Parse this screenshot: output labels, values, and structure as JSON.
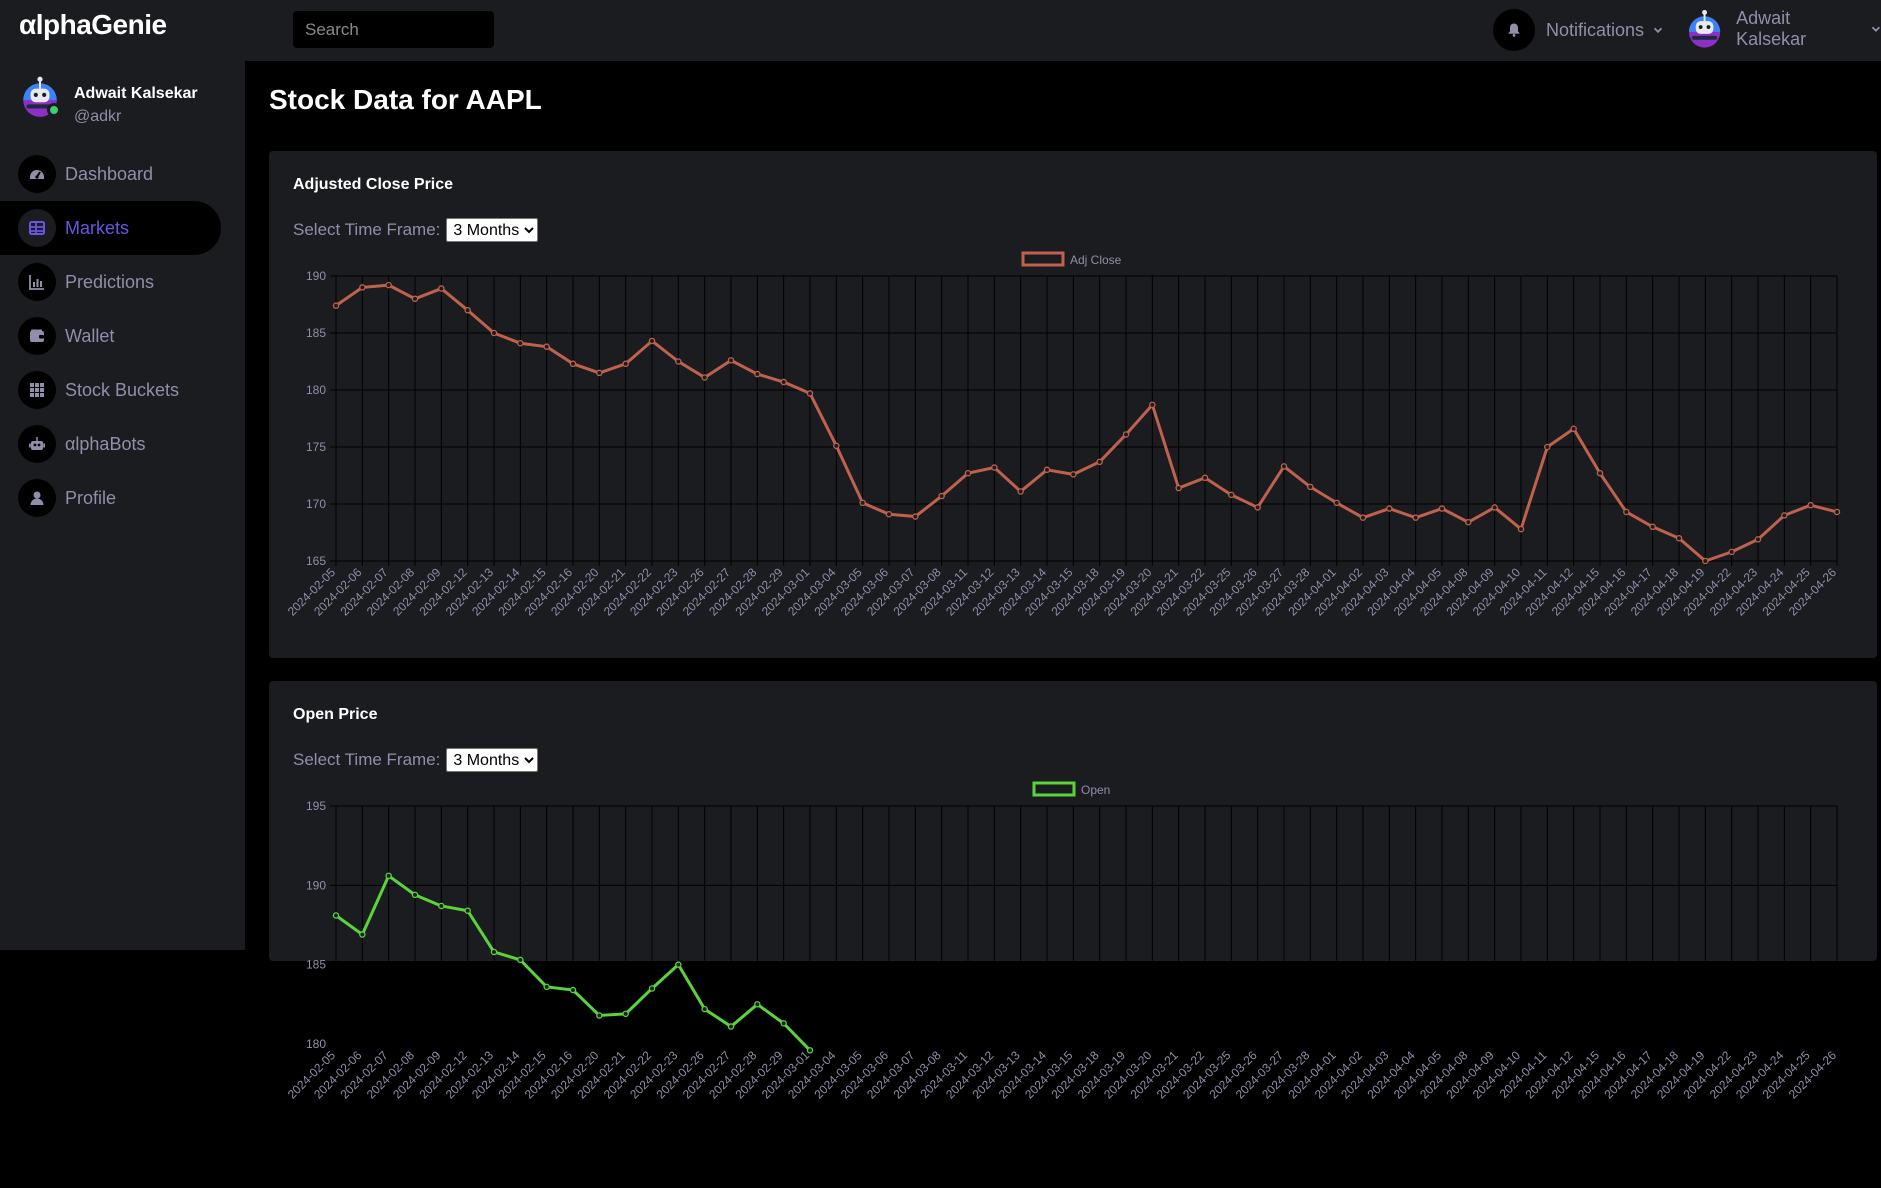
{
  "app": {
    "logo": "αlphaGenie"
  },
  "search": {
    "placeholder": "Search"
  },
  "header": {
    "notifications_label": "Notifications",
    "user_name": "Adwait Kalsekar"
  },
  "profile": {
    "name": "Adwait Kalsekar",
    "handle": "@adkr"
  },
  "sidebar": {
    "items": [
      {
        "label": "Dashboard",
        "icon": "dashboard-icon",
        "active": false
      },
      {
        "label": "Markets",
        "icon": "table-icon",
        "active": true
      },
      {
        "label": "Predictions",
        "icon": "bar-chart-icon",
        "active": false
      },
      {
        "label": "Wallet",
        "icon": "wallet-icon",
        "active": false
      },
      {
        "label": "Stock Buckets",
        "icon": "grid-icon",
        "active": false
      },
      {
        "label": "αlphaBots",
        "icon": "robot-icon",
        "active": false
      },
      {
        "label": "Profile",
        "icon": "user-icon",
        "active": false
      }
    ]
  },
  "page": {
    "title": "Stock Data for AAPL"
  },
  "cards": [
    {
      "title": "Adjusted Close Price",
      "timeframe_label": "Select Time Frame:",
      "timeframe_value": "3 Months",
      "timeframe_options": [
        "3 Months"
      ]
    },
    {
      "title": "Open Price",
      "timeframe_label": "Select Time Frame:",
      "timeframe_value": "3 Months",
      "timeframe_options": [
        "3 Months"
      ]
    }
  ],
  "colors": {
    "accent": "#6a54e0",
    "adj_close_line": "#c0614d",
    "open_line": "#5ad43a",
    "card_bg": "#1b1c20"
  },
  "chart_data": [
    {
      "type": "line",
      "title": "",
      "xlabel": "",
      "ylabel": "",
      "ylim": [
        165,
        190
      ],
      "yticks": [
        165,
        170,
        175,
        180,
        185,
        190
      ],
      "legend_position": "top-center",
      "grid": true,
      "x": [
        "2024-02-05",
        "2024-02-06",
        "2024-02-07",
        "2024-02-08",
        "2024-02-09",
        "2024-02-12",
        "2024-02-13",
        "2024-02-14",
        "2024-02-15",
        "2024-02-16",
        "2024-02-20",
        "2024-02-21",
        "2024-02-22",
        "2024-02-23",
        "2024-02-26",
        "2024-02-27",
        "2024-02-28",
        "2024-02-29",
        "2024-03-01",
        "2024-03-04",
        "2024-03-05",
        "2024-03-06",
        "2024-03-07",
        "2024-03-08",
        "2024-03-11",
        "2024-03-12",
        "2024-03-13",
        "2024-03-14",
        "2024-03-15",
        "2024-03-18",
        "2024-03-19",
        "2024-03-20",
        "2024-03-21",
        "2024-03-22",
        "2024-03-25",
        "2024-03-26",
        "2024-03-27",
        "2024-03-28",
        "2024-04-01",
        "2024-04-02",
        "2024-04-03",
        "2024-04-04",
        "2024-04-05",
        "2024-04-08",
        "2024-04-09",
        "2024-04-10",
        "2024-04-11",
        "2024-04-12",
        "2024-04-15",
        "2024-04-16",
        "2024-04-17",
        "2024-04-18",
        "2024-04-19",
        "2024-04-22",
        "2024-04-23",
        "2024-04-24",
        "2024-04-25",
        "2024-04-26"
      ],
      "series": [
        {
          "name": "Adj Close",
          "color": "#c0614d",
          "values": [
            187.4,
            189.0,
            189.2,
            188.0,
            188.9,
            187.0,
            185.0,
            184.1,
            183.8,
            182.3,
            181.5,
            182.3,
            184.3,
            182.5,
            181.1,
            182.6,
            181.4,
            180.7,
            179.7,
            175.1,
            170.1,
            169.1,
            168.9,
            170.7,
            172.7,
            173.2,
            171.1,
            173.0,
            172.6,
            173.7,
            176.1,
            178.7,
            171.4,
            172.3,
            170.8,
            169.7,
            173.3,
            171.5,
            170.1,
            168.8,
            169.6,
            168.8,
            169.6,
            168.4,
            169.7,
            167.8,
            175.0,
            176.6,
            172.7,
            169.3,
            168.0,
            167.0,
            165.0,
            165.8,
            166.9,
            169.0,
            169.9,
            169.3
          ]
        }
      ]
    },
    {
      "type": "line",
      "title": "",
      "xlabel": "",
      "ylabel": "",
      "ylim": [
        180,
        195
      ],
      "yticks": [
        180,
        185,
        190,
        195
      ],
      "legend_position": "top-center",
      "grid": true,
      "x": [
        "2024-02-05",
        "2024-02-06",
        "2024-02-07",
        "2024-02-08",
        "2024-02-09",
        "2024-02-12",
        "2024-02-13",
        "2024-02-14",
        "2024-02-15",
        "2024-02-16",
        "2024-02-20",
        "2024-02-21",
        "2024-02-22",
        "2024-02-23",
        "2024-02-26",
        "2024-02-27",
        "2024-02-28",
        "2024-02-29",
        "2024-03-01",
        "2024-03-04",
        "2024-03-05",
        "2024-03-06",
        "2024-03-07",
        "2024-03-08",
        "2024-03-11",
        "2024-03-12",
        "2024-03-13",
        "2024-03-14",
        "2024-03-15",
        "2024-03-18",
        "2024-03-19",
        "2024-03-20",
        "2024-03-21",
        "2024-03-22",
        "2024-03-25",
        "2024-03-26",
        "2024-03-27",
        "2024-03-28",
        "2024-04-01",
        "2024-04-02",
        "2024-04-03",
        "2024-04-04",
        "2024-04-05",
        "2024-04-08",
        "2024-04-09",
        "2024-04-10",
        "2024-04-11",
        "2024-04-12",
        "2024-04-15",
        "2024-04-16",
        "2024-04-17",
        "2024-04-18",
        "2024-04-19",
        "2024-04-22",
        "2024-04-23",
        "2024-04-24",
        "2024-04-25",
        "2024-04-26"
      ],
      "series": [
        {
          "name": "Open",
          "color": "#5ad43a",
          "values": [
            188.1,
            186.9,
            190.6,
            189.4,
            188.7,
            188.4,
            185.8,
            185.3,
            183.6,
            183.4,
            181.8,
            181.9,
            183.5,
            185.0,
            182.2,
            181.1,
            182.5,
            181.3,
            179.6
          ]
        }
      ]
    }
  ]
}
